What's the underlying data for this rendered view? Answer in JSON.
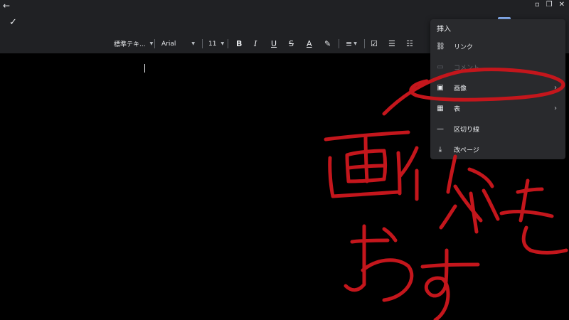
{
  "window": {
    "back_glyph": "←",
    "minimize_glyph": "▫",
    "maximize_glyph": "❐",
    "close_glyph": "✕"
  },
  "appbar": {
    "done_glyph": "✓"
  },
  "toolbar": {
    "style_label": "標準テキ...",
    "font_label": "Arial",
    "size_label": "11",
    "bold": "B",
    "italic": "I",
    "underline": "U",
    "strike": "S",
    "text_color": "A"
  },
  "menu": {
    "title": "挿入",
    "items": [
      {
        "label": "リンク",
        "icon": "link-icon",
        "glyph": "⛓",
        "has_submenu": false,
        "enabled": true
      },
      {
        "label": "コメント",
        "icon": "comment-icon",
        "glyph": "▭",
        "has_submenu": false,
        "enabled": false
      },
      {
        "label": "画像",
        "icon": "image-icon",
        "glyph": "▣",
        "has_submenu": true,
        "enabled": true
      },
      {
        "label": "表",
        "icon": "table-icon",
        "glyph": "▦",
        "has_submenu": true,
        "enabled": true
      },
      {
        "label": "区切り線",
        "icon": "horizontal-line-icon",
        "glyph": "—",
        "has_submenu": false,
        "enabled": true
      },
      {
        "label": "改ページ",
        "icon": "page-break-icon",
        "glyph": "⤓",
        "has_submenu": false,
        "enabled": true
      }
    ],
    "submenu_glyph": "›"
  },
  "annotation": {
    "ink_color": "#c4161c"
  }
}
